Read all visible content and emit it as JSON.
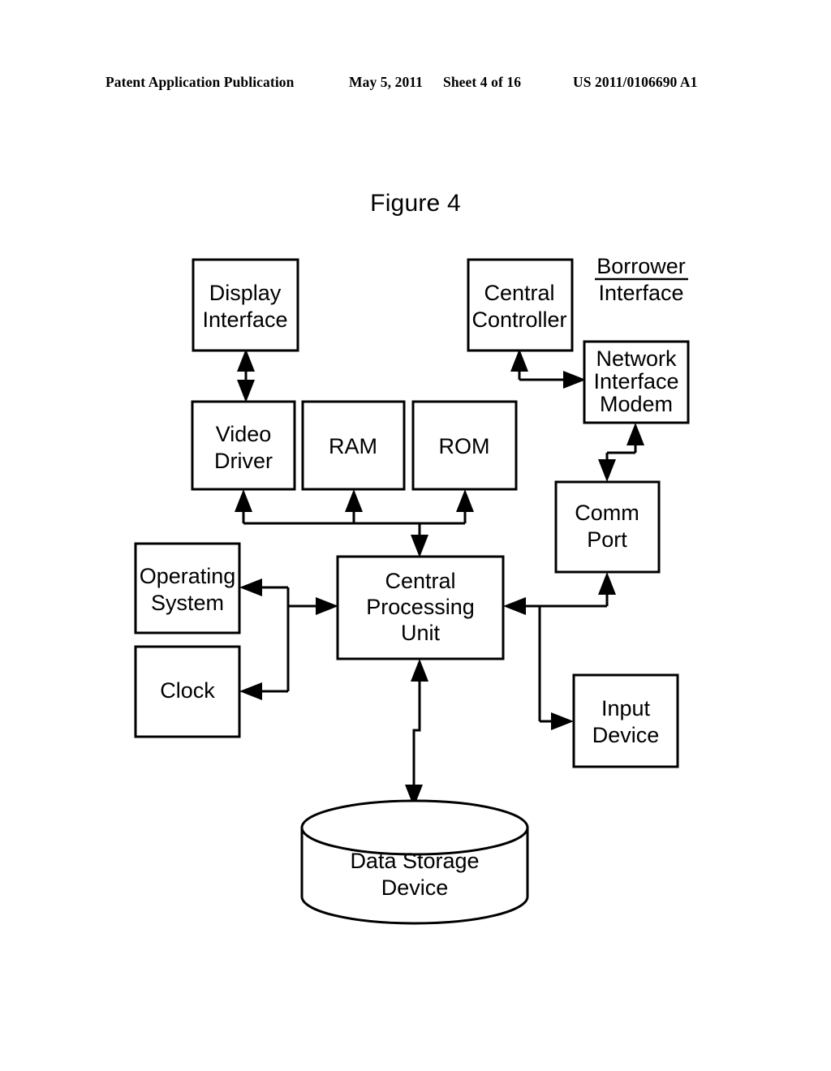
{
  "header": {
    "publication": "Patent Application Publication",
    "date": "May 5, 2011",
    "sheet": "Sheet 4 of 16",
    "patent_number": "US 2011/0106690 A1"
  },
  "figure": {
    "title": "Figure 4"
  },
  "diagram": {
    "free_labels": {
      "borrower_interface_line1": "Borrower",
      "borrower_interface_line2": "Interface"
    },
    "nodes": {
      "display_interface": {
        "line1": "Display",
        "line2": "Interface"
      },
      "central_controller": {
        "line1": "Central",
        "line2": "Controller"
      },
      "network_interface_modem": {
        "line1": "Network",
        "line2": "Interface",
        "line3": "Modem"
      },
      "video_driver": {
        "line1": "Video",
        "line2": "Driver"
      },
      "ram": {
        "line1": "RAM"
      },
      "rom": {
        "line1": "ROM"
      },
      "comm_port": {
        "line1": "Comm",
        "line2": "Port"
      },
      "operating_system": {
        "line1": "Operating",
        "line2": "System"
      },
      "clock": {
        "line1": "Clock"
      },
      "central_processing_unit": {
        "line1": "Central",
        "line2": "Processing",
        "line3": "Unit"
      },
      "input_device": {
        "line1": "Input",
        "line2": "Device"
      },
      "data_storage_device": {
        "line1": "Data Storage",
        "line2": "Device"
      }
    },
    "colors": {
      "stroke": "#000000",
      "fill": "#ffffff"
    }
  }
}
